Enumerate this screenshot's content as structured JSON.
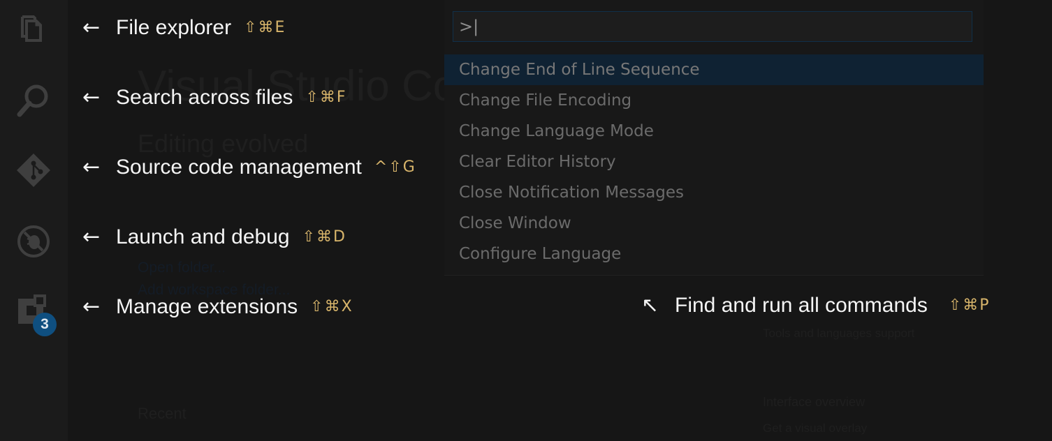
{
  "activity_bar": {
    "items": [
      {
        "icon": "files-icon"
      },
      {
        "icon": "search-icon"
      },
      {
        "icon": "git-icon"
      },
      {
        "icon": "debug-icon"
      },
      {
        "icon": "extensions-icon",
        "badge": "3"
      }
    ]
  },
  "callouts": [
    {
      "label": "File explorer",
      "shortcut": "⇧⌘E"
    },
    {
      "label": "Search across files",
      "shortcut": "⇧⌘F"
    },
    {
      "label": "Source code management",
      "shortcut": "^⇧G"
    },
    {
      "label": "Launch and debug",
      "shortcut": "⇧⌘D"
    },
    {
      "label": "Manage extensions",
      "shortcut": "⇧⌘X"
    }
  ],
  "arrow_glyph": "←",
  "command_palette": {
    "input_value": ">|",
    "items": [
      "Change End of Line Sequence",
      "Change File Encoding",
      "Change Language Mode",
      "Clear Editor History",
      "Close Notification Messages",
      "Close Window",
      "Configure Language"
    ],
    "selected_index": 0
  },
  "commands_callout": {
    "arrow": "↖",
    "label": "Find and run all commands",
    "shortcut": "⇧⌘P"
  },
  "colors": {
    "shortcut": "#d8b56b",
    "badge": "#0f4f80",
    "selection": "#0f2233"
  }
}
